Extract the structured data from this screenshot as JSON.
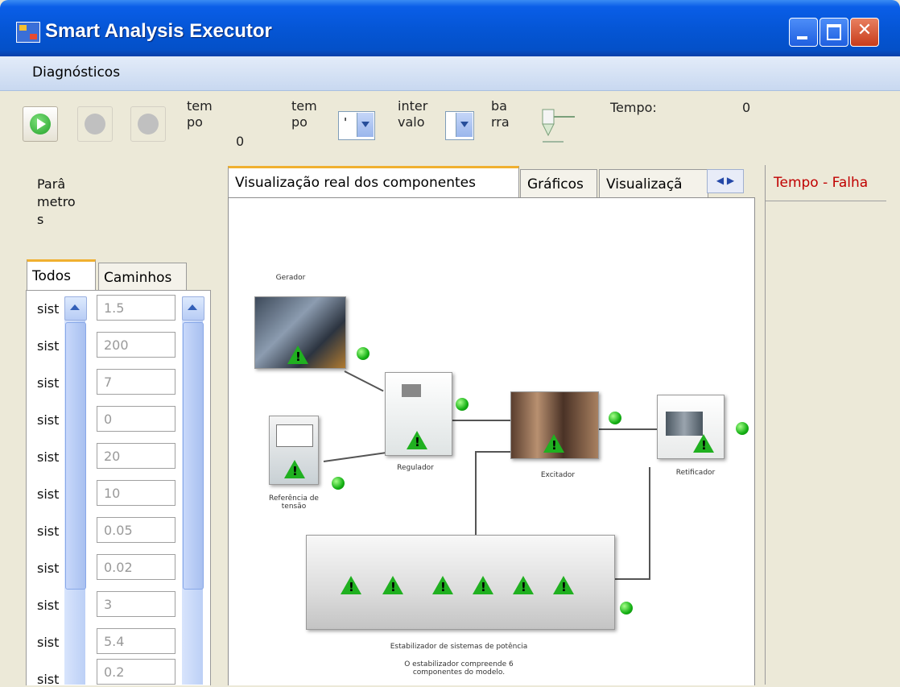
{
  "window": {
    "title": "Smart Analysis Executor"
  },
  "menu": {
    "items": [
      "Diagnósticos"
    ]
  },
  "toolbar": {
    "tempo1_label": "tem\npo",
    "tempo1_value": "0",
    "tempo2_label": "tem\npo",
    "tempo2_value": "'",
    "intervalo_label": "inter\nvalo",
    "barra_label": "ba\nrra",
    "tempo_label": "Tempo:",
    "tempo_value": "0"
  },
  "left": {
    "parametros_label": "Parâ\nmetro\ns",
    "tabs": [
      "Todos",
      "Caminhos"
    ],
    "row_label": "sist",
    "values": [
      "1.5",
      "200",
      "7",
      "0",
      "20",
      "10",
      "0.05",
      "0.02",
      "3",
      "5.4",
      "0.2"
    ]
  },
  "main": {
    "tabs": [
      "Visualização real dos componentes",
      "Gráficos",
      "Visualizaçã"
    ],
    "diagram": {
      "gerador": "Gerador",
      "regulador": "Regulador",
      "excitador": "Excitador",
      "retificador": "Retificador",
      "referencia": "Referência de\ntensão",
      "estabilizador": "Estabilizador de sistemas de potência",
      "estabilizador_note": "O estabilizador compreende 6\ncomponentes do modelo."
    }
  },
  "right": {
    "header": "Tempo - Falha"
  }
}
